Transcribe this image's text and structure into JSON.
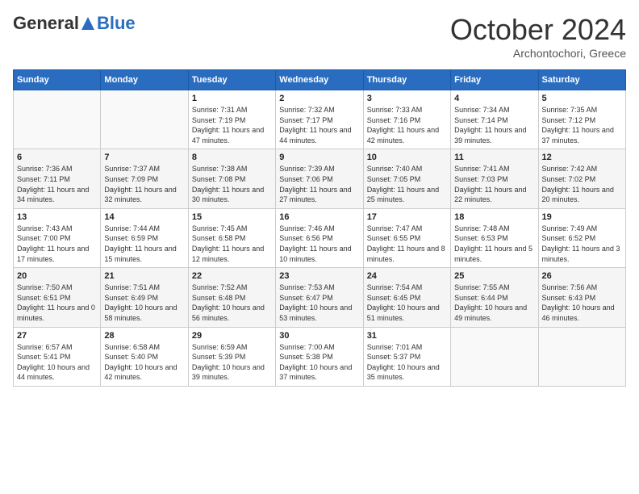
{
  "header": {
    "logo_general": "General",
    "logo_blue": "Blue",
    "month_title": "October 2024",
    "location": "Archontochori, Greece"
  },
  "days_of_week": [
    "Sunday",
    "Monday",
    "Tuesday",
    "Wednesday",
    "Thursday",
    "Friday",
    "Saturday"
  ],
  "weeks": [
    [
      {
        "day": "",
        "sunrise": "",
        "sunset": "",
        "daylight": ""
      },
      {
        "day": "",
        "sunrise": "",
        "sunset": "",
        "daylight": ""
      },
      {
        "day": "1",
        "sunrise": "Sunrise: 7:31 AM",
        "sunset": "Sunset: 7:19 PM",
        "daylight": "Daylight: 11 hours and 47 minutes."
      },
      {
        "day": "2",
        "sunrise": "Sunrise: 7:32 AM",
        "sunset": "Sunset: 7:17 PM",
        "daylight": "Daylight: 11 hours and 44 minutes."
      },
      {
        "day": "3",
        "sunrise": "Sunrise: 7:33 AM",
        "sunset": "Sunset: 7:16 PM",
        "daylight": "Daylight: 11 hours and 42 minutes."
      },
      {
        "day": "4",
        "sunrise": "Sunrise: 7:34 AM",
        "sunset": "Sunset: 7:14 PM",
        "daylight": "Daylight: 11 hours and 39 minutes."
      },
      {
        "day": "5",
        "sunrise": "Sunrise: 7:35 AM",
        "sunset": "Sunset: 7:12 PM",
        "daylight": "Daylight: 11 hours and 37 minutes."
      }
    ],
    [
      {
        "day": "6",
        "sunrise": "Sunrise: 7:36 AM",
        "sunset": "Sunset: 7:11 PM",
        "daylight": "Daylight: 11 hours and 34 minutes."
      },
      {
        "day": "7",
        "sunrise": "Sunrise: 7:37 AM",
        "sunset": "Sunset: 7:09 PM",
        "daylight": "Daylight: 11 hours and 32 minutes."
      },
      {
        "day": "8",
        "sunrise": "Sunrise: 7:38 AM",
        "sunset": "Sunset: 7:08 PM",
        "daylight": "Daylight: 11 hours and 30 minutes."
      },
      {
        "day": "9",
        "sunrise": "Sunrise: 7:39 AM",
        "sunset": "Sunset: 7:06 PM",
        "daylight": "Daylight: 11 hours and 27 minutes."
      },
      {
        "day": "10",
        "sunrise": "Sunrise: 7:40 AM",
        "sunset": "Sunset: 7:05 PM",
        "daylight": "Daylight: 11 hours and 25 minutes."
      },
      {
        "day": "11",
        "sunrise": "Sunrise: 7:41 AM",
        "sunset": "Sunset: 7:03 PM",
        "daylight": "Daylight: 11 hours and 22 minutes."
      },
      {
        "day": "12",
        "sunrise": "Sunrise: 7:42 AM",
        "sunset": "Sunset: 7:02 PM",
        "daylight": "Daylight: 11 hours and 20 minutes."
      }
    ],
    [
      {
        "day": "13",
        "sunrise": "Sunrise: 7:43 AM",
        "sunset": "Sunset: 7:00 PM",
        "daylight": "Daylight: 11 hours and 17 minutes."
      },
      {
        "day": "14",
        "sunrise": "Sunrise: 7:44 AM",
        "sunset": "Sunset: 6:59 PM",
        "daylight": "Daylight: 11 hours and 15 minutes."
      },
      {
        "day": "15",
        "sunrise": "Sunrise: 7:45 AM",
        "sunset": "Sunset: 6:58 PM",
        "daylight": "Daylight: 11 hours and 12 minutes."
      },
      {
        "day": "16",
        "sunrise": "Sunrise: 7:46 AM",
        "sunset": "Sunset: 6:56 PM",
        "daylight": "Daylight: 11 hours and 10 minutes."
      },
      {
        "day": "17",
        "sunrise": "Sunrise: 7:47 AM",
        "sunset": "Sunset: 6:55 PM",
        "daylight": "Daylight: 11 hours and 8 minutes."
      },
      {
        "day": "18",
        "sunrise": "Sunrise: 7:48 AM",
        "sunset": "Sunset: 6:53 PM",
        "daylight": "Daylight: 11 hours and 5 minutes."
      },
      {
        "day": "19",
        "sunrise": "Sunrise: 7:49 AM",
        "sunset": "Sunset: 6:52 PM",
        "daylight": "Daylight: 11 hours and 3 minutes."
      }
    ],
    [
      {
        "day": "20",
        "sunrise": "Sunrise: 7:50 AM",
        "sunset": "Sunset: 6:51 PM",
        "daylight": "Daylight: 11 hours and 0 minutes."
      },
      {
        "day": "21",
        "sunrise": "Sunrise: 7:51 AM",
        "sunset": "Sunset: 6:49 PM",
        "daylight": "Daylight: 10 hours and 58 minutes."
      },
      {
        "day": "22",
        "sunrise": "Sunrise: 7:52 AM",
        "sunset": "Sunset: 6:48 PM",
        "daylight": "Daylight: 10 hours and 56 minutes."
      },
      {
        "day": "23",
        "sunrise": "Sunrise: 7:53 AM",
        "sunset": "Sunset: 6:47 PM",
        "daylight": "Daylight: 10 hours and 53 minutes."
      },
      {
        "day": "24",
        "sunrise": "Sunrise: 7:54 AM",
        "sunset": "Sunset: 6:45 PM",
        "daylight": "Daylight: 10 hours and 51 minutes."
      },
      {
        "day": "25",
        "sunrise": "Sunrise: 7:55 AM",
        "sunset": "Sunset: 6:44 PM",
        "daylight": "Daylight: 10 hours and 49 minutes."
      },
      {
        "day": "26",
        "sunrise": "Sunrise: 7:56 AM",
        "sunset": "Sunset: 6:43 PM",
        "daylight": "Daylight: 10 hours and 46 minutes."
      }
    ],
    [
      {
        "day": "27",
        "sunrise": "Sunrise: 6:57 AM",
        "sunset": "Sunset: 5:41 PM",
        "daylight": "Daylight: 10 hours and 44 minutes."
      },
      {
        "day": "28",
        "sunrise": "Sunrise: 6:58 AM",
        "sunset": "Sunset: 5:40 PM",
        "daylight": "Daylight: 10 hours and 42 minutes."
      },
      {
        "day": "29",
        "sunrise": "Sunrise: 6:59 AM",
        "sunset": "Sunset: 5:39 PM",
        "daylight": "Daylight: 10 hours and 39 minutes."
      },
      {
        "day": "30",
        "sunrise": "Sunrise: 7:00 AM",
        "sunset": "Sunset: 5:38 PM",
        "daylight": "Daylight: 10 hours and 37 minutes."
      },
      {
        "day": "31",
        "sunrise": "Sunrise: 7:01 AM",
        "sunset": "Sunset: 5:37 PM",
        "daylight": "Daylight: 10 hours and 35 minutes."
      },
      {
        "day": "",
        "sunrise": "",
        "sunset": "",
        "daylight": ""
      },
      {
        "day": "",
        "sunrise": "",
        "sunset": "",
        "daylight": ""
      }
    ]
  ]
}
